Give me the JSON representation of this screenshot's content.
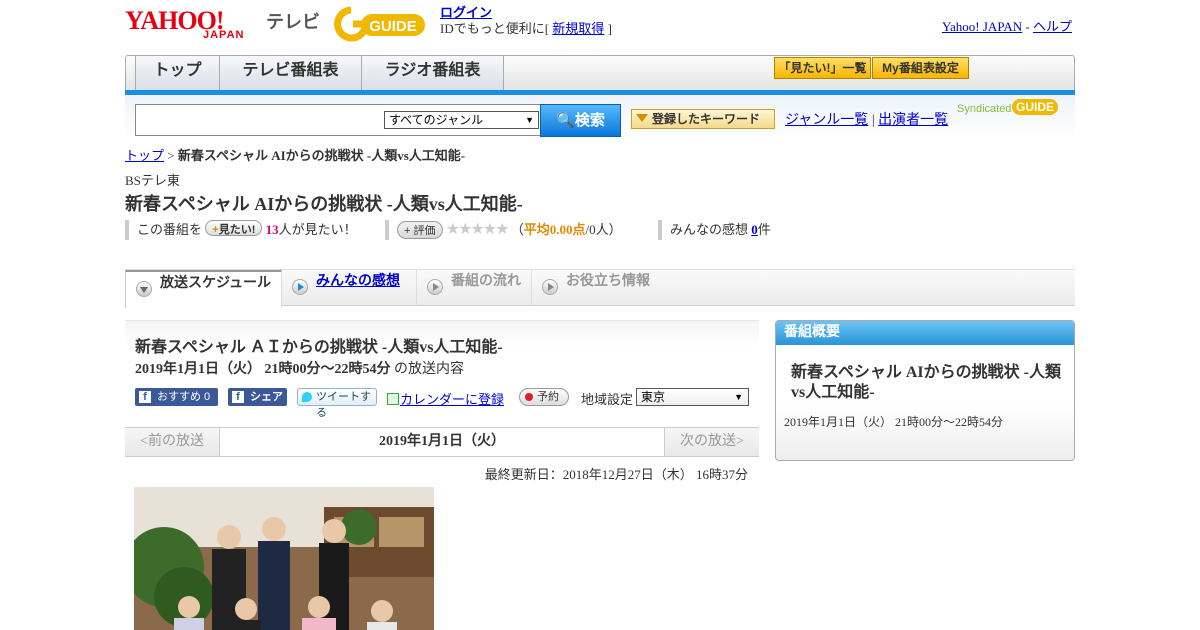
{
  "header": {
    "yahoo_logo": "YAHOO!",
    "yahoo_sub": "JAPAN",
    "tv_label": "テレビ",
    "gguide_logo": "GUIDE",
    "login": "ログイン",
    "login_note": "IDでもっと便利に[",
    "signup": "新規取得",
    "signup_close": "]",
    "yahoo_japan_link": "Yahoo! JAPAN",
    "sep": "-",
    "help_link": "ヘルプ"
  },
  "nav": {
    "tabs": [
      "トップ",
      "テレビ番組表",
      "ラジオ番組表"
    ],
    "mitai_list": "「見たい!」一覧",
    "my_bangumi": "My番組表設定"
  },
  "search": {
    "genre_selected": "すべてのジャンル",
    "button": "検索",
    "keyword_btn": "登録したキーワード",
    "genre_list": "ジャンル一覧",
    "divider": "|",
    "performers": "出演者一覧",
    "syndicated": "Syndicated",
    "syndicated_logo": "GUIDE"
  },
  "breadcrumb": {
    "top": "トップ",
    "sep": ">",
    "current": "新春スペシャル AIからの挑戦状 -人類vs人工知能-"
  },
  "program": {
    "channel": "BSテレ東",
    "title": "新春スペシャル AIからの挑戦状 -人類vs人工知能-",
    "kono": "この番組を",
    "mitai_btn": "見たい!",
    "mitai_count": "13",
    "mitai_suffix": "人が見たい！",
    "hyoka_btn": "評価",
    "stars": "★★★★★",
    "avg_open": "（",
    "avg_label": "平均0.00点",
    "avg_count": "/0人）",
    "kanso_label": "みんなの感想",
    "kanso_count": "0",
    "kanso_suffix": "件"
  },
  "content_tabs": [
    "放送スケジュール",
    "みんなの感想",
    "番組の流れ",
    "お役立ち情報"
  ],
  "schedule": {
    "title": "新春スペシャル ＡＩからの挑戦状 -人類vs人工知能-",
    "date_time": "2019年1月1日（火） 21時00分～22時54分",
    "date_suffix": "の放送内容",
    "fb_recommend": "おすすめ 0",
    "fb_share": "シェア",
    "tweet": "ツイートする",
    "calendar": "カレンダーに登録",
    "reserve": "予約",
    "region_label": "地域設定",
    "region_value": "東京",
    "prev": "<前の放送",
    "current_date": "2019年1月1日（火）",
    "next": "次の放送>",
    "updated": "最終更新日：2018年12月27日（木） 16時37分"
  },
  "side": {
    "heading": "番組概要",
    "title": "新春スペシャル AIからの挑戦状 -人類vs人工知能-",
    "date_time": "2019年1月1日（火） 21時00分～22時54分"
  },
  "colors": {
    "accent_blue": "#1a8ee0",
    "yahoo_red": "#e50012",
    "gguide_yellow": "#f0b800",
    "pink_count": "#e0007a"
  }
}
